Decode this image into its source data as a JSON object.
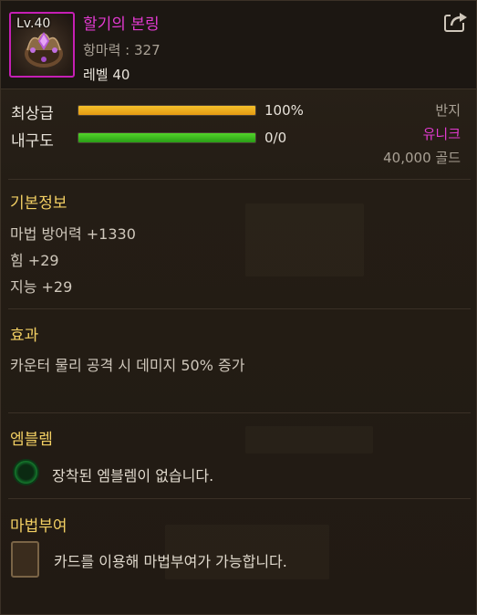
{
  "header": {
    "level_tag": "Lv.40",
    "item_name": "할기의 본링",
    "attack_power": "항마력 : 327",
    "item_level": "레벨 40"
  },
  "stats": {
    "grade_label": "최상급",
    "grade_percent": 100,
    "grade_value": "100%",
    "durability_label": "내구도",
    "durability_percent": 100,
    "durability_value": "0/0"
  },
  "info": {
    "type": "반지",
    "rarity": "유니크",
    "price": "40,000 골드"
  },
  "basic_info": {
    "title": "기본정보",
    "lines": [
      "마법 방어력 +1330",
      "힘 +29",
      "지능 +29"
    ]
  },
  "effect": {
    "title": "효과",
    "line": "카운터 물리 공격 시 데미지 50% 증가"
  },
  "emblem": {
    "title": "엠블렘",
    "text": "장착된 엠블렘이 없습니다."
  },
  "enchant": {
    "title": "마법부여",
    "text": "카드를 이용해 마법부여가 가능합니다."
  },
  "colors": {
    "unique": "#e23ad0",
    "section_title": "#f2cf63",
    "grade_bar": "#f0b323",
    "durability_bar": "#3cbf1e"
  },
  "icons": {
    "share": "share-arrow-icon",
    "item": "ring-item-icon",
    "emblem_slot": "emblem-slot-icon",
    "card_slot": "card-slot-icon"
  }
}
